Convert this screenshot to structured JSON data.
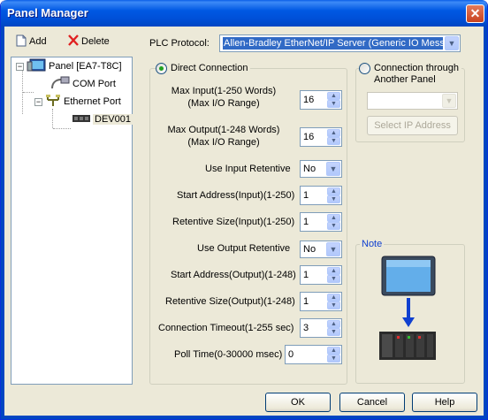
{
  "window": {
    "title": "Panel Manager",
    "close_glyph": "✕"
  },
  "toolbar": {
    "add_label": "Add",
    "delete_label": "Delete"
  },
  "tree": {
    "root_label": "Panel [EA7-T8C]",
    "com_port_label": "COM Port",
    "ethernet_port_label": "Ethernet Port",
    "device_label": "DEV001",
    "collapse_glyph": "−"
  },
  "protocol": {
    "label": "PLC Protocol:",
    "value": "Allen-Bradley EtherNet/IP Server (Generic IO Messaging)"
  },
  "direct": {
    "radio_label": "Direct Connection",
    "max_input_label": "Max Input(1-250 Words)\n(Max I/O Range)",
    "max_input_value": "16",
    "max_output_label": "Max Output(1-248 Words)\n(Max I/O Range)",
    "max_output_value": "16",
    "use_input_retentive_label": "Use Input Retentive",
    "use_input_retentive_value": "No",
    "start_input_label": "Start Address(Input)(1-250)",
    "start_input_value": "1",
    "ret_size_input_label": "Retentive Size(Input)(1-250)",
    "ret_size_input_value": "1",
    "use_output_retentive_label": "Use Output Retentive",
    "use_output_retentive_value": "No",
    "start_output_label": "Start Address(Output)(1-248)",
    "start_output_value": "1",
    "ret_size_output_label": "Retentive Size(Output)(1-248)",
    "ret_size_output_value": "1",
    "timeout_label": "Connection Timeout(1-255 sec)",
    "timeout_value": "3",
    "poll_label": "Poll Time(0-30000 msec)",
    "poll_value": "0"
  },
  "other": {
    "radio_label": "Connection through\nAnother Panel",
    "select_ip_label": "Select IP Address"
  },
  "note": {
    "label": "Note"
  },
  "buttons": {
    "ok": "OK",
    "cancel": "Cancel",
    "help": "Help"
  },
  "colors": {
    "accent_green": "#21a121",
    "title_blue": "#0058e3",
    "arrow_blue": "#1040d0"
  },
  "icons": {
    "add": "add-document-icon",
    "delete": "delete-x-icon",
    "panel": "monitor-icon",
    "com": "com-port-icon",
    "ethernet": "ethernet-port-icon",
    "device": "device-icon"
  }
}
